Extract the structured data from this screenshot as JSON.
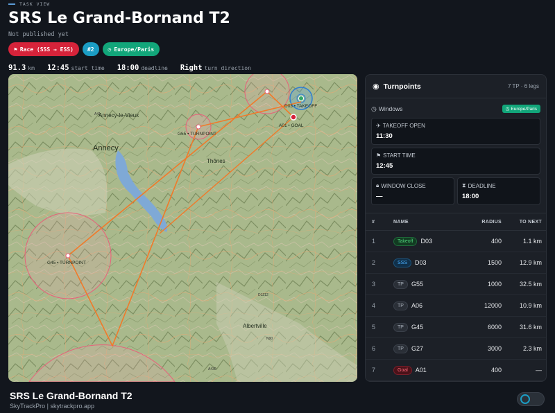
{
  "header": {
    "kicker": "TASK VIEW",
    "title": "SRS Le Grand-Bornand T2",
    "subtitle": "Not published yet",
    "chips": {
      "race": "Race (SSS → ESS)",
      "number": "#2",
      "timezone": "Europe/Paris"
    },
    "stats": [
      {
        "value": "91.3 km",
        "unit": "km"
      },
      {
        "value": "12:45",
        "unit": "start time"
      },
      {
        "value": "18:00",
        "unit": "deadline"
      },
      {
        "value": "Right",
        "unit": "turn direction"
      }
    ]
  },
  "map": {
    "labels": {
      "annecy_vieux": "Annecy-le-Vieux",
      "annecy": "Annecy",
      "thones": "Thônes",
      "albertville": "Albertville",
      "a41": "A41",
      "d1212": "D1212",
      "n90": "N90",
      "a430": "A430",
      "tp_d03": "D03 • TAKEOFF",
      "tp_a01": "A01 • GOAL",
      "tp_g55": "G55 • TURNPOINT",
      "tp_g45": "G45 • TURNPOINT"
    }
  },
  "panel": {
    "title": "Turnpoints",
    "meta": "7 TP · 6 legs",
    "windows_label": "Windows",
    "windows_tz": "Europe/Paris",
    "takeoff_open_label": "TAKEOFF OPEN",
    "takeoff_open_value": "11:30",
    "start_time_label": "START TIME",
    "start_time_value": "12:45",
    "window_close_label": "WINDOW CLOSE",
    "window_close_value": "—",
    "deadline_label": "DEADLINE",
    "deadline_value": "18:00",
    "columns": {
      "idx": "#",
      "name": "NAME",
      "radius": "RADIUS",
      "next": "TO NEXT"
    },
    "rows": [
      {
        "idx": "1",
        "type": "Takeoff",
        "name": "D03",
        "radius": "400",
        "next": "1.1 km"
      },
      {
        "idx": "2",
        "type": "SSS",
        "name": "D03",
        "radius": "1500",
        "next": "12.9 km"
      },
      {
        "idx": "3",
        "type": "TP",
        "name": "G55",
        "radius": "1000",
        "next": "32.5 km"
      },
      {
        "idx": "4",
        "type": "TP",
        "name": "A06",
        "radius": "12000",
        "next": "10.9 km"
      },
      {
        "idx": "5",
        "type": "TP",
        "name": "G45",
        "radius": "6000",
        "next": "31.6 km"
      },
      {
        "idx": "6",
        "type": "TP",
        "name": "G27",
        "radius": "3000",
        "next": "2.3 km"
      },
      {
        "idx": "7",
        "type": "Goal",
        "name": "A01",
        "radius": "400",
        "next": "—"
      }
    ]
  },
  "footer": {
    "title": "SRS Le Grand-Bornand T2",
    "subtitle": "SkyTrackPro | skytrackpro.app"
  },
  "colors": {
    "race": "#d6233a",
    "number": "#1b9dc4",
    "timezone": "#12a67a",
    "route": "#f07a2a",
    "cylinder": "#e8607a"
  }
}
